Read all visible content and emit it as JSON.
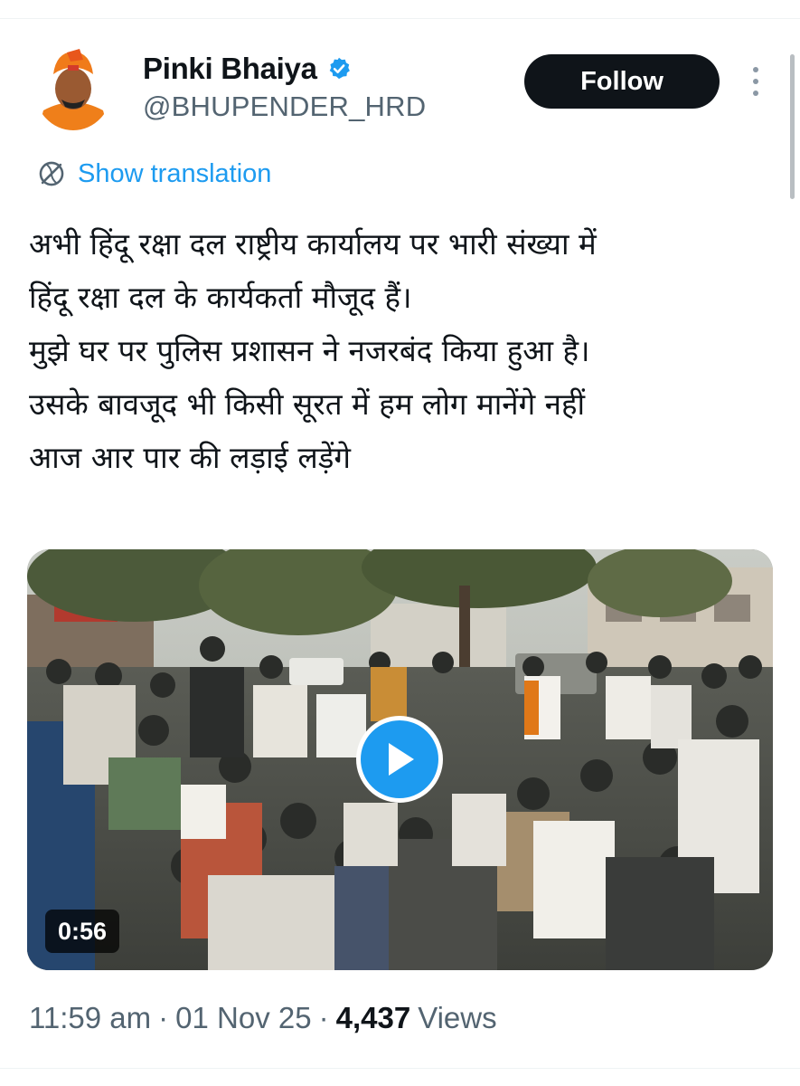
{
  "author": {
    "display_name": "Pinki Bhaiya",
    "handle": "@BHUPENDER_HRD",
    "verified": true,
    "avatar_icon": "profile-photo"
  },
  "actions": {
    "follow_label": "Follow",
    "more_icon": "more-vertical-icon"
  },
  "translation": {
    "label": "Show translation",
    "icon": "translate-globe-icon"
  },
  "tweet": {
    "lines": [
      "अभी हिंदू रक्षा दल राष्ट्रीय कार्यालय पर भारी संख्या में",
      "हिंदू रक्षा दल के कार्यकर्ता मौजूद हैं।",
      "मुझे घर पर पुलिस प्रशासन ने नजरबंद किया हुआ है।",
      "उसके बावजूद भी किसी सूरत में हम लोग मानेंगे नहीं",
      "आज आर पार की लड़ाई लड़ेंगे"
    ]
  },
  "media": {
    "type": "video",
    "duration": "0:56",
    "play_icon": "play-icon"
  },
  "meta": {
    "time": "11:59 am",
    "separator": "·",
    "date": "01 Nov 25",
    "views_count": "4,437",
    "views_label": "Views"
  },
  "colors": {
    "accent": "#1d9bf0",
    "text_primary": "#0f1419",
    "text_secondary": "#536471",
    "follow_bg": "#0f1419"
  }
}
